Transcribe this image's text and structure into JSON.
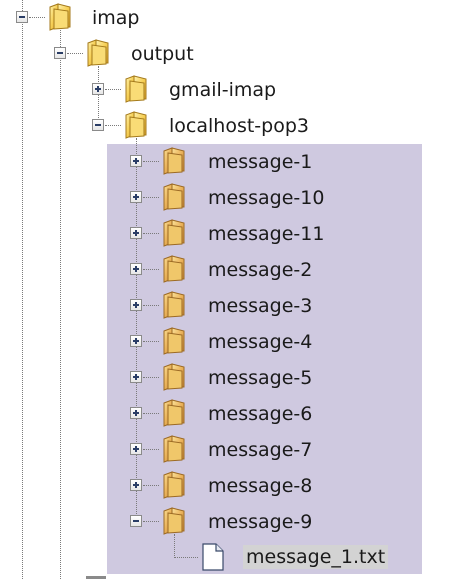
{
  "tree": {
    "root": {
      "label": "imap",
      "expanded": true,
      "children": [
        {
          "label": "output",
          "expanded": true,
          "children": [
            {
              "label": "gmail-imap",
              "expanded": false
            },
            {
              "label": "localhost-pop3",
              "expanded": true,
              "children": [
                {
                  "label": "message-1",
                  "expanded": false
                },
                {
                  "label": "message-10",
                  "expanded": false
                },
                {
                  "label": "message-11",
                  "expanded": false
                },
                {
                  "label": "message-2",
                  "expanded": false
                },
                {
                  "label": "message-3",
                  "expanded": false
                },
                {
                  "label": "message-4",
                  "expanded": false
                },
                {
                  "label": "message-5",
                  "expanded": false
                },
                {
                  "label": "message-6",
                  "expanded": false
                },
                {
                  "label": "message-7",
                  "expanded": false
                },
                {
                  "label": "message-8",
                  "expanded": false
                },
                {
                  "label": "message-9",
                  "expanded": true,
                  "children": [
                    {
                      "label": "message_1.txt",
                      "type": "file",
                      "selected": true
                    }
                  ]
                }
              ]
            }
          ]
        }
      ]
    }
  },
  "colors": {
    "selection_background": "#cfc9e0",
    "folder_yellow": "#f3c84a",
    "folder_orange_tint": "#e8a36a",
    "file_selected_background": "#d3d3d3",
    "expander_glyph": "#2a3d66"
  },
  "icons": {
    "folder": "folder-icon",
    "file": "text-file-icon",
    "expand": "plus-expander",
    "collapse": "minus-expander"
  }
}
